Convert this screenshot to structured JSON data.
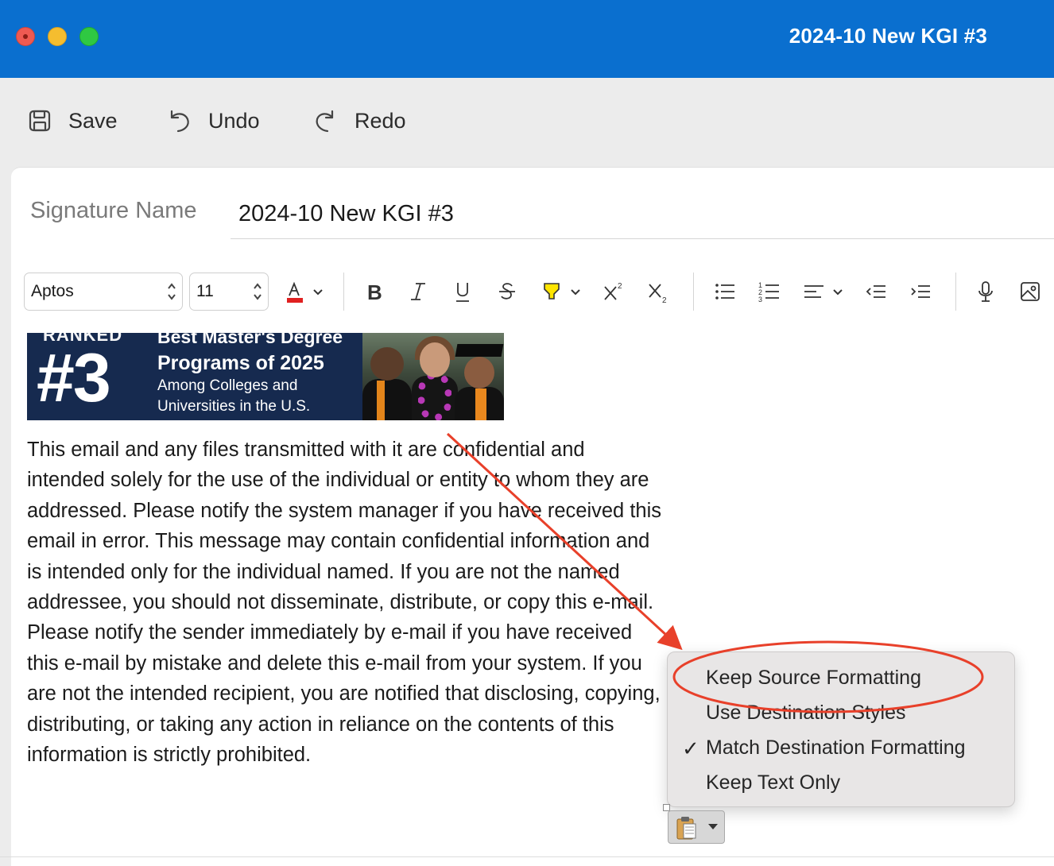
{
  "window": {
    "title": "2024-10 New KGI #3"
  },
  "toolbar": {
    "save_label": "Save",
    "undo_label": "Undo",
    "redo_label": "Redo"
  },
  "signature": {
    "label": "Signature Name",
    "value": "2024-10 New KGI #3"
  },
  "format": {
    "font": "Aptos",
    "size": "11",
    "font_color": "#e02020",
    "highlight_color": "#ffe500",
    "icons": [
      "text-color-icon",
      "bold-icon",
      "italic-icon",
      "underline-icon",
      "strikethrough-icon",
      "highlight-icon",
      "superscript-icon",
      "subscript-icon",
      "bullet-list-icon",
      "numbered-list-icon",
      "align-icon",
      "decrease-indent-icon",
      "increase-indent-icon",
      "dictate-icon",
      "insert-picture-icon"
    ]
  },
  "banner": {
    "ranked": "RANKED",
    "headline_top": "Best Master's Degree",
    "number": "#3",
    "programs": "Programs of 2025",
    "line1": "Among Colleges and",
    "line2": "Universities in the U.S."
  },
  "body_text": "This email and any files transmitted with it are confidential and intended solely for the use of the individual or entity to whom they are addressed. Please notify the system manager if you have received this email in error. This message may contain confidential information and is intended only for the individual named. If you are not the named addressee, you should not disseminate, distribute, or copy this e-mail. Please notify the sender immediately by e-mail if you have received this e-mail by mistake and delete this e-mail from your system. If you are not the intended recipient, you are notified that disclosing, copying, distributing, or taking any action in reliance on the contents of this information is strictly prohibited.",
  "paste_menu": {
    "items": [
      {
        "label": "Keep Source Formatting",
        "checked": false
      },
      {
        "label": "Use Destination Styles",
        "checked": false
      },
      {
        "label": "Match Destination Formatting",
        "checked": true
      },
      {
        "label": "Keep Text Only",
        "checked": false
      }
    ],
    "check_mark": "✓"
  },
  "annotation_color": "#e8402a"
}
